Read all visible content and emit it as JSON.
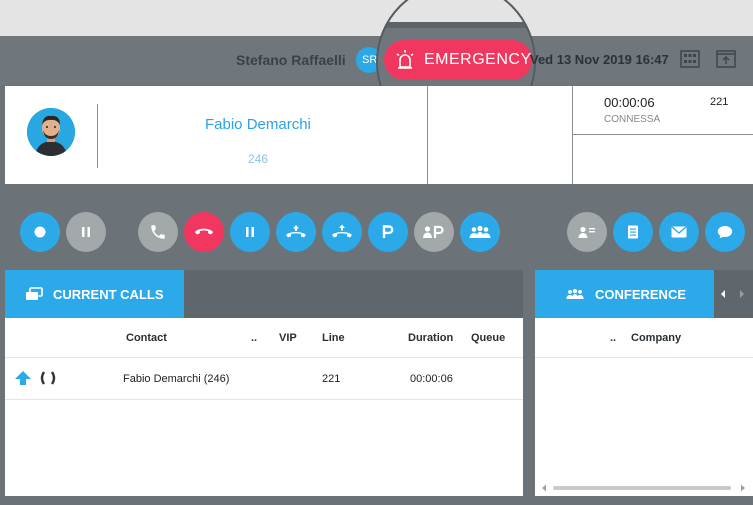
{
  "header": {
    "user_name": "Stefano Raffaelli",
    "user_initials": "SR",
    "datetime": "Ved 13 Nov 2019 16:47",
    "emergency_label": "EMERGENCY"
  },
  "active_call": {
    "contact_name": "Fabio Demarchi",
    "contact_number": "246",
    "timer": "00:00:06",
    "status": "CONNESSA",
    "line": "221"
  },
  "current_calls": {
    "title": "CURRENT CALLS",
    "columns": [
      "Contact",
      "..",
      "VIP",
      "Line",
      "Duration",
      "Queue"
    ],
    "rows": [
      {
        "contact": "Fabio Demarchi (246)",
        "line": "221",
        "duration": "00:00:06"
      }
    ]
  },
  "conference": {
    "title": "CONFERENCE",
    "columns": [
      "..",
      "Company"
    ]
  },
  "colors": {
    "accent": "#2ba9e9",
    "danger": "#f1375f",
    "neutral": "#a3a8ab",
    "panel_bg": "#6b7379"
  }
}
